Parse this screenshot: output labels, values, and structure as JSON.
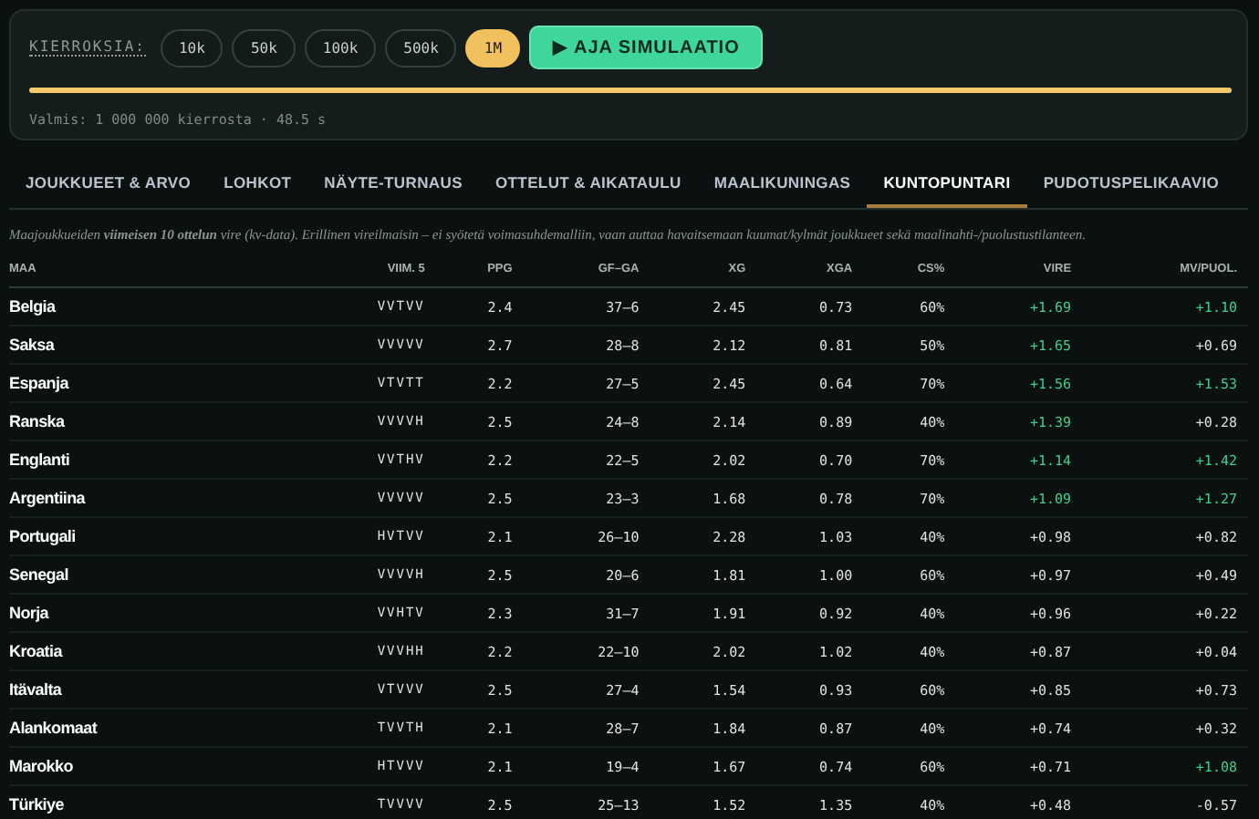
{
  "controls": {
    "label": "KIERROKSIA:",
    "options": [
      {
        "label": "10k",
        "selected": false
      },
      {
        "label": "50k",
        "selected": false
      },
      {
        "label": "100k",
        "selected": false
      },
      {
        "label": "500k",
        "selected": false
      },
      {
        "label": "1M",
        "selected": true
      }
    ],
    "run_button": "▶ AJA SIMULAATIO",
    "progress": {
      "level": 1
    },
    "status": "Valmis: 1 000 000 kierrosta · 48.5 s"
  },
  "tabs": [
    {
      "label": "JOUKKUEET & ARVO",
      "selected": false
    },
    {
      "label": "LOHKOT",
      "selected": false
    },
    {
      "label": "NÄYTE-TURNAUS",
      "selected": false
    },
    {
      "label": "OTTELUT & AIKATAULU",
      "selected": false
    },
    {
      "label": "MAALIKUNINGAS",
      "selected": false
    },
    {
      "label": "KUNTOPUNTARI",
      "selected": true
    },
    {
      "label": "PUDOTUSPELIKAAVIO",
      "selected": false
    }
  ],
  "description": "Maajoukkueiden **viimeisen 10 ottelun** vire (kv-data). Erillinen vireilmaisin – ei syötetä voimasuhdemalliin, vaan auttaa havaitsemaan kuumat/kylmät joukkueet sekä maalinahti-/puolustustilanteen.",
  "table": {
    "columns": [
      "MAA",
      "VIIM. 5",
      "PPG",
      "GF–GA",
      "XG",
      "XGA",
      "CS%",
      "VIRE",
      "MV/PUOL."
    ],
    "rows": [
      {
        "cells": [
          "Belgia",
          "VVTVV",
          "2.4",
          "37–6",
          "2.45",
          "0.73",
          "60%",
          "+1.69",
          "+1.10"
        ],
        "vire_hot": true,
        "mv_hot": true
      },
      {
        "cells": [
          "Saksa",
          "VVVVV",
          "2.7",
          "28–8",
          "2.12",
          "0.81",
          "50%",
          "+1.65",
          "+0.69"
        ],
        "vire_hot": true,
        "mv_hot": false
      },
      {
        "cells": [
          "Espanja",
          "VTVTT",
          "2.2",
          "27–5",
          "2.45",
          "0.64",
          "70%",
          "+1.56",
          "+1.53"
        ],
        "vire_hot": true,
        "mv_hot": true
      },
      {
        "cells": [
          "Ranska",
          "VVVVH",
          "2.5",
          "24–8",
          "2.14",
          "0.89",
          "40%",
          "+1.39",
          "+0.28"
        ],
        "vire_hot": true,
        "mv_hot": false
      },
      {
        "cells": [
          "Englanti",
          "VVTHV",
          "2.2",
          "22–5",
          "2.02",
          "0.70",
          "70%",
          "+1.14",
          "+1.42"
        ],
        "vire_hot": true,
        "mv_hot": true
      },
      {
        "cells": [
          "Argentiina",
          "VVVVV",
          "2.5",
          "23–3",
          "1.68",
          "0.78",
          "70%",
          "+1.09",
          "+1.27"
        ],
        "vire_hot": true,
        "mv_hot": true
      },
      {
        "cells": [
          "Portugali",
          "HVTVV",
          "2.1",
          "26–10",
          "2.28",
          "1.03",
          "40%",
          "+0.98",
          "+0.82"
        ],
        "vire_hot": false,
        "mv_hot": false
      },
      {
        "cells": [
          "Senegal",
          "VVVVH",
          "2.5",
          "20–6",
          "1.81",
          "1.00",
          "60%",
          "+0.97",
          "+0.49"
        ],
        "vire_hot": false,
        "mv_hot": false
      },
      {
        "cells": [
          "Norja",
          "VVHTV",
          "2.3",
          "31–7",
          "1.91",
          "0.92",
          "40%",
          "+0.96",
          "+0.22"
        ],
        "vire_hot": false,
        "mv_hot": false
      },
      {
        "cells": [
          "Kroatia",
          "VVVHH",
          "2.2",
          "22–10",
          "2.02",
          "1.02",
          "40%",
          "+0.87",
          "+0.04"
        ],
        "vire_hot": false,
        "mv_hot": false
      },
      {
        "cells": [
          "Itävalta",
          "VTVVV",
          "2.5",
          "27–4",
          "1.54",
          "0.93",
          "60%",
          "+0.85",
          "+0.73"
        ],
        "vire_hot": false,
        "mv_hot": false
      },
      {
        "cells": [
          "Alankomaat",
          "TVVTH",
          "2.1",
          "28–7",
          "1.84",
          "0.87",
          "40%",
          "+0.74",
          "+0.32"
        ],
        "vire_hot": false,
        "mv_hot": false
      },
      {
        "cells": [
          "Marokko",
          "HTVVV",
          "2.1",
          "19–4",
          "1.67",
          "0.74",
          "60%",
          "+0.71",
          "+1.08"
        ],
        "vire_hot": false,
        "mv_hot": true
      },
      {
        "cells": [
          "Türkiye",
          "TVVVV",
          "2.5",
          "25–13",
          "1.52",
          "1.35",
          "40%",
          "+0.48",
          "-0.57"
        ],
        "vire_hot": false,
        "mv_hot": false
      }
    ]
  }
}
